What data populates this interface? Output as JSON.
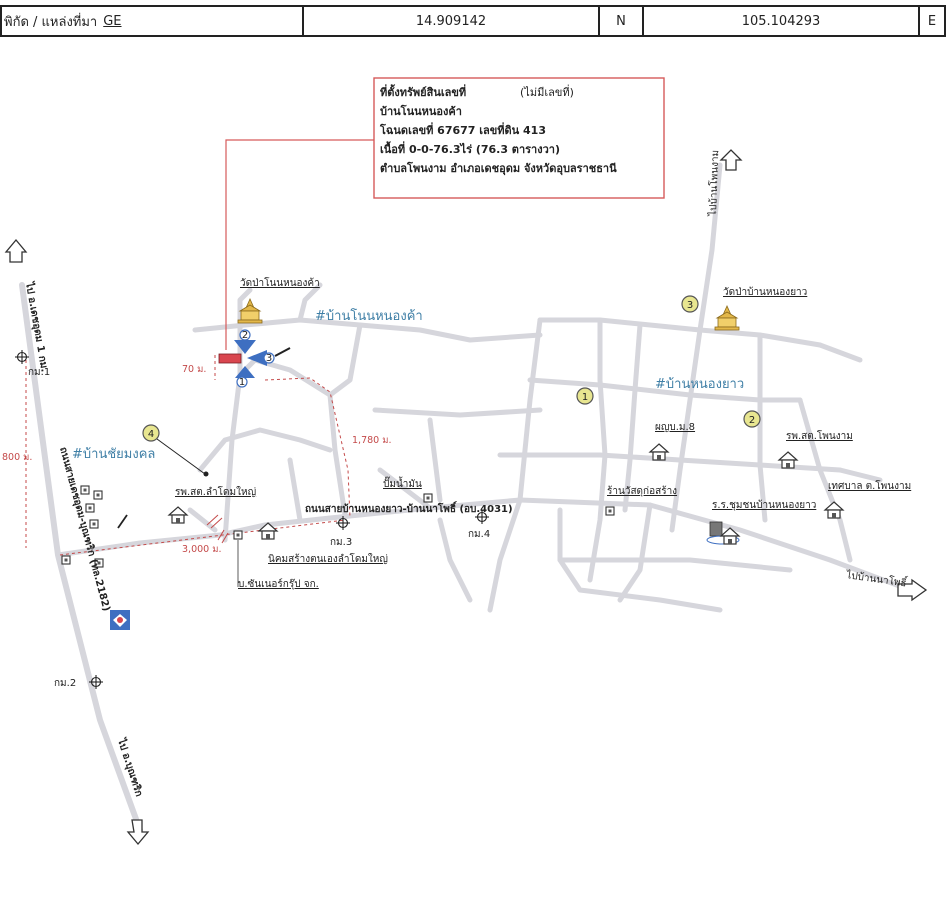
{
  "header": {
    "coord_label": "พิกัด / แหล่งที่มา",
    "coord_source": "GE",
    "latitude": "14.909142",
    "lat_dir": "N",
    "longitude": "105.104293",
    "lon_dir": "E"
  },
  "info_box": {
    "line1_title": "ที่ตั้งทรัพย์สินเลขที่",
    "line1_note": "(ไม่มีเลขที่)",
    "line2": "บ้านโนนหนองค้า",
    "line3": "โฉนดเลขที่ 67677   เลขที่ดิน 413",
    "line4": "เนื้อที่  0-0-76.3ไร่  (76.3 ตารางวา)",
    "line5": "ตำบลโพนงาม  อำเภอเดชอุดม  จังหวัดอุบลราชธานี"
  },
  "villages": {
    "non_nong_kha": "#บ้านโนนหนองค้า",
    "nong_yao": "#บ้านหนองยาว",
    "chai_mongkhon": "#บ้านชัยมงคล"
  },
  "landmarks": {
    "wat_non": "วัดป่าโนนหนองค้า",
    "wat_nong_yao": "วัดป่าบ้านหนองยาว",
    "phuyai": "ผญบ.ม.8",
    "rps_phon_ngam": "รพ.สต.โพนงาม",
    "tessaban": "เทศบาล  ต.โพนงาม",
    "school": "ร.ร.ชุมชนบ้านหนองยาว",
    "shop": "ร้านวัสดุก่อสร้าง",
    "gas": "ปั๊มน้ำมัน",
    "rps_lam": "รพ.สต.ลำโดมใหญ่",
    "nikhom": "นิคมสร้างตนเองลำโดมใหญ่",
    "company": "บ.ซันเนอร์กรุ๊ป  จก.",
    "road_main": "ถนนสายบ้านหนองยาว-บ้านนาโพธิ์ (อบ.4031)",
    "road_hwy": "ถนนสายเดชอุดม-บุณฑริก (ทล.2182)",
    "to_detudom": "ไป อ.เดชอุดม 1 กม.",
    "to_buntharik": "ไป อ.บุณฑริก",
    "to_naphosi": "ไปบ้านนาโพธิ์",
    "to_north": "ไปบ้านโพนงาม"
  },
  "markers": {
    "gm1": "กม.1",
    "gm2": "กม.2",
    "gm3": "กม.3",
    "gm4": "กม.4",
    "n1": "1",
    "n2": "2",
    "n3": "3",
    "n4": "4",
    "p1": "1",
    "p2": "2",
    "p3": "3"
  },
  "distances": {
    "d70": "70 ม.",
    "d800": "800 ม.",
    "d1780": "1,780 ม.",
    "d3000": "3,000 ม."
  },
  "colors": {
    "road": "#d6d6dc",
    "route": "#c44a4a",
    "village_text": "#3f7fa6",
    "temple": "#e3b84a",
    "marker_blue": "#3e6fc1",
    "parcel": "#d9464f",
    "info_border": "#d65a5a",
    "circle_fill": "#e8e690"
  }
}
